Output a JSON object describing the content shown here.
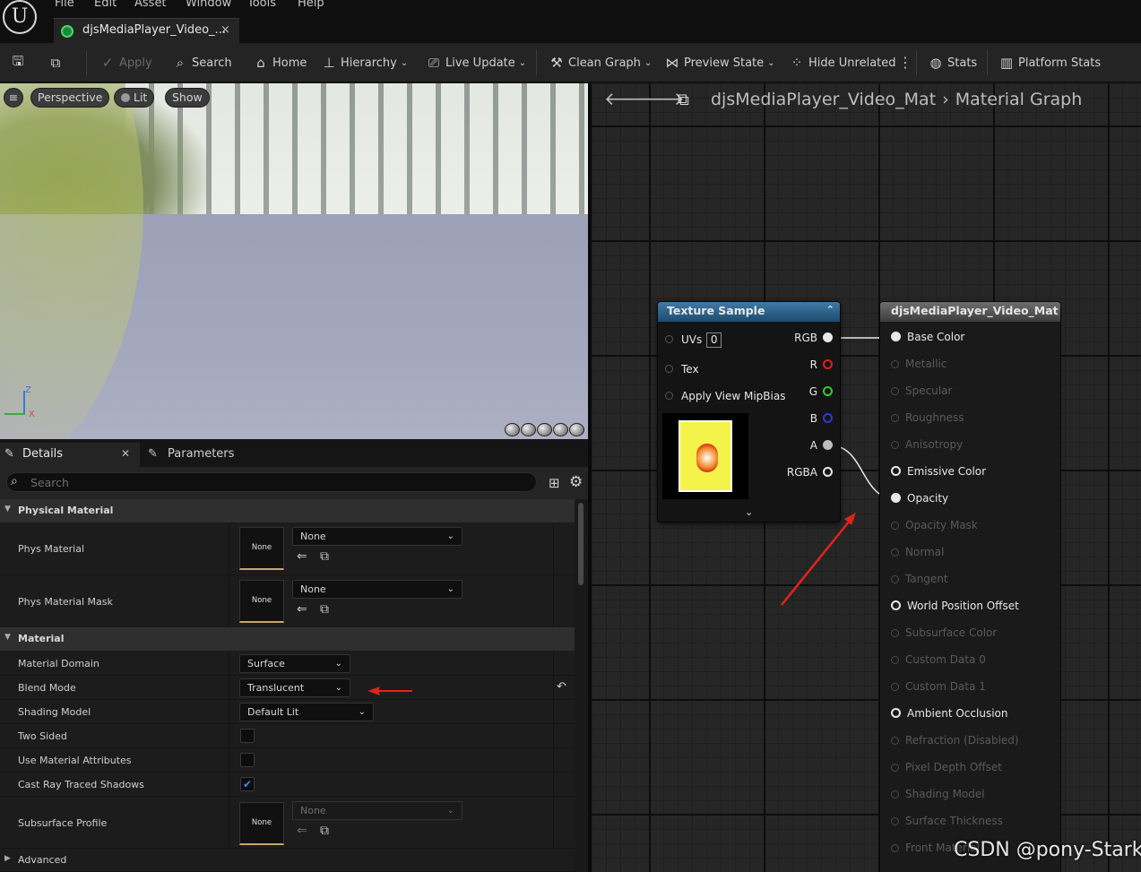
{
  "menu": {
    "items": [
      "File",
      "Edit",
      "Asset",
      "Window",
      "Tools",
      "Help"
    ]
  },
  "logo": {
    "glyph": "U"
  },
  "tab": {
    "title": "djsMediaPlayer_Video_...",
    "close": "×"
  },
  "toolbar": {
    "save_icon": "save-icon",
    "browse_icon": "browse-icon",
    "apply": "Apply",
    "search": "Search",
    "home": "Home",
    "hierarchy": "Hierarchy",
    "live_update": "Live Update",
    "clean_graph": "Clean Graph",
    "preview_state": "Preview State",
    "hide_unrelated": "Hide Unrelated",
    "stats": "Stats",
    "platform_stats": "Platform Stats"
  },
  "viewport": {
    "menu_icon": "≡",
    "perspective": "Perspective",
    "lit": "Lit",
    "show": "Show",
    "axis_z": "Z",
    "axis_x": "X"
  },
  "details": {
    "tab_details": "Details",
    "tab_parameters": "Parameters",
    "search_placeholder": "Search",
    "categories": {
      "physical_material": "Physical Material",
      "material": "Material",
      "advanced": "Advanced"
    },
    "rows": {
      "phys_material": {
        "label": "Phys Material",
        "thumb": "None",
        "value": "None"
      },
      "phys_material_mask": {
        "label": "Phys Material Mask",
        "thumb": "None",
        "value": "None"
      },
      "material_domain": {
        "label": "Material Domain",
        "value": "Surface"
      },
      "blend_mode": {
        "label": "Blend Mode",
        "value": "Translucent"
      },
      "shading_model": {
        "label": "Shading Model",
        "value": "Default Lit"
      },
      "two_sided": {
        "label": "Two Sided",
        "checked": false
      },
      "use_material_attributes": {
        "label": "Use Material Attributes",
        "checked": false
      },
      "cast_ray_traced_shadows": {
        "label": "Cast Ray Traced Shadows",
        "checked": true
      },
      "subsurface_profile": {
        "label": "Subsurface Profile",
        "thumb": "None",
        "value": "None"
      }
    }
  },
  "graph": {
    "breadcrumb": {
      "asset": "djsMediaPlayer_Video_Mat",
      "graph": "Material Graph"
    },
    "texture_node": {
      "title": "Texture Sample",
      "inputs": [
        "UVs",
        "Tex",
        "Apply View MipBias"
      ],
      "uv_index": "0",
      "outputs": [
        "RGB",
        "R",
        "G",
        "B",
        "A",
        "RGBA"
      ]
    },
    "material_node": {
      "title": "djsMediaPlayer_Video_Mat",
      "pins": [
        {
          "label": "Base Color",
          "state": "connected"
        },
        {
          "label": "Metallic",
          "state": "disabled"
        },
        {
          "label": "Specular",
          "state": "disabled"
        },
        {
          "label": "Roughness",
          "state": "disabled"
        },
        {
          "label": "Anisotropy",
          "state": "disabled"
        },
        {
          "label": "Emissive Color",
          "state": "enabled"
        },
        {
          "label": "Opacity",
          "state": "connected"
        },
        {
          "label": "Opacity Mask",
          "state": "disabled"
        },
        {
          "label": "Normal",
          "state": "disabled"
        },
        {
          "label": "Tangent",
          "state": "disabled"
        },
        {
          "label": "World Position Offset",
          "state": "enabled"
        },
        {
          "label": "Subsurface Color",
          "state": "disabled"
        },
        {
          "label": "Custom Data 0",
          "state": "disabled"
        },
        {
          "label": "Custom Data 1",
          "state": "disabled"
        },
        {
          "label": "Ambient Occlusion",
          "state": "enabled"
        },
        {
          "label": "Refraction (Disabled)",
          "state": "disabled"
        },
        {
          "label": "Pixel Depth Offset",
          "state": "disabled"
        },
        {
          "label": "Shading Model",
          "state": "disabled"
        },
        {
          "label": "Surface Thickness",
          "state": "disabled"
        },
        {
          "label": "Front Material",
          "state": "disabled"
        }
      ]
    }
  },
  "watermark": "CSDN @pony-Stark",
  "colors": {
    "accent_red": "#e0241b",
    "pin_r": "#e02020",
    "pin_g": "#2fd02f",
    "pin_b": "#2d3ad8",
    "node_header_texture": "#2d6690"
  }
}
